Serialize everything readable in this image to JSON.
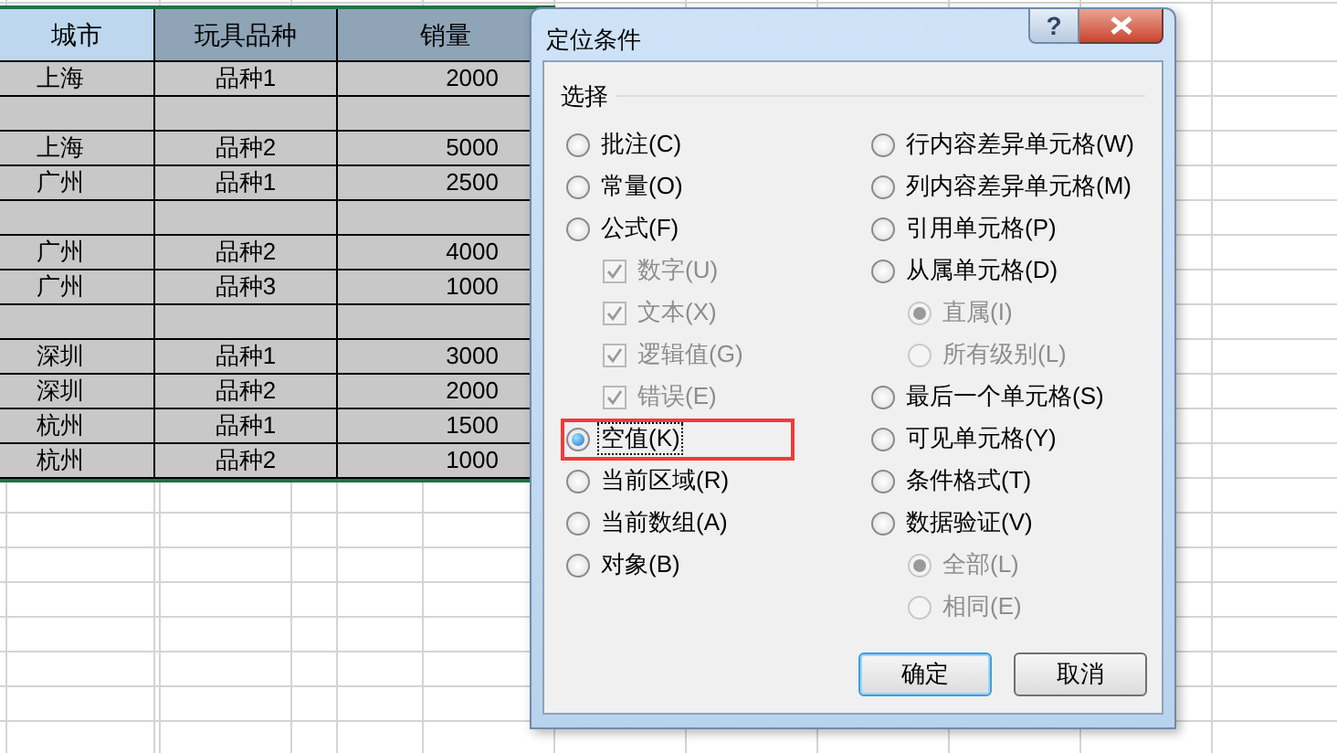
{
  "sheet": {
    "columns": [
      {
        "label": "城市",
        "active": true
      },
      {
        "label": "玩具品种",
        "active": false
      },
      {
        "label": "销量",
        "active": false
      }
    ],
    "rows": [
      {
        "kind": "data",
        "cells": [
          "上海",
          "品种1",
          "2000"
        ]
      },
      {
        "kind": "blank"
      },
      {
        "kind": "data",
        "cells": [
          "上海",
          "品种2",
          "5000"
        ]
      },
      {
        "kind": "data",
        "cells": [
          "广州",
          "品种1",
          "2500"
        ]
      },
      {
        "kind": "blank"
      },
      {
        "kind": "data",
        "cells": [
          "广州",
          "品种2",
          "4000"
        ]
      },
      {
        "kind": "data",
        "cells": [
          "广州",
          "品种3",
          "1000"
        ]
      },
      {
        "kind": "blank"
      },
      {
        "kind": "data",
        "cells": [
          "深圳",
          "品种1",
          "3000"
        ]
      },
      {
        "kind": "data",
        "cells": [
          "深圳",
          "品种2",
          "2000"
        ]
      },
      {
        "kind": "data",
        "cells": [
          "杭州",
          "品种1",
          "1500"
        ]
      },
      {
        "kind": "data",
        "cells": [
          "杭州",
          "品种2",
          "1000"
        ]
      }
    ]
  },
  "dialog": {
    "title": "定位条件",
    "help_button": "?",
    "group_label": "选择",
    "left_options": [
      {
        "kind": "radio",
        "label": "批注(C)",
        "selected": false,
        "highlighted": false
      },
      {
        "kind": "radio",
        "label": "常量(O)",
        "selected": false,
        "highlighted": false
      },
      {
        "kind": "radio",
        "label": "公式(F)",
        "selected": false,
        "highlighted": false,
        "children": [
          {
            "kind": "checkbox",
            "label": "数字(U)",
            "checked": true,
            "disabled": true
          },
          {
            "kind": "checkbox",
            "label": "文本(X)",
            "checked": true,
            "disabled": true
          },
          {
            "kind": "checkbox",
            "label": "逻辑值(G)",
            "checked": true,
            "disabled": true
          },
          {
            "kind": "checkbox",
            "label": "错误(E)",
            "checked": true,
            "disabled": true
          }
        ]
      },
      {
        "kind": "radio",
        "label": "空值(K)",
        "selected": true,
        "highlighted": true
      },
      {
        "kind": "radio",
        "label": "当前区域(R)",
        "selected": false,
        "highlighted": false
      },
      {
        "kind": "radio",
        "label": "当前数组(A)",
        "selected": false,
        "highlighted": false
      },
      {
        "kind": "radio",
        "label": "对象(B)",
        "selected": false,
        "highlighted": false
      }
    ],
    "right_options": [
      {
        "kind": "radio",
        "label": "行内容差异单元格(W)",
        "selected": false,
        "highlighted": false
      },
      {
        "kind": "radio",
        "label": "列内容差异单元格(M)",
        "selected": false,
        "highlighted": false
      },
      {
        "kind": "radio",
        "label": "引用单元格(P)",
        "selected": false,
        "highlighted": false
      },
      {
        "kind": "radio",
        "label": "从属单元格(D)",
        "selected": false,
        "highlighted": false,
        "children": [
          {
            "kind": "radio",
            "label": "直属(I)",
            "selected": true,
            "disabled": true
          },
          {
            "kind": "radio",
            "label": "所有级别(L)",
            "selected": false,
            "disabled": true
          }
        ]
      },
      {
        "kind": "radio",
        "label": "最后一个单元格(S)",
        "selected": false,
        "highlighted": false
      },
      {
        "kind": "radio",
        "label": "可见单元格(Y)",
        "selected": false,
        "highlighted": false
      },
      {
        "kind": "radio",
        "label": "条件格式(T)",
        "selected": false,
        "highlighted": false
      },
      {
        "kind": "radio",
        "label": "数据验证(V)",
        "selected": false,
        "highlighted": false,
        "children": [
          {
            "kind": "radio",
            "label": "全部(L)",
            "selected": true,
            "disabled": true
          },
          {
            "kind": "radio",
            "label": "相同(E)",
            "selected": false,
            "disabled": true
          }
        ]
      }
    ],
    "buttons": [
      {
        "label": "确定",
        "default": true
      },
      {
        "label": "取消",
        "default": false
      }
    ]
  }
}
